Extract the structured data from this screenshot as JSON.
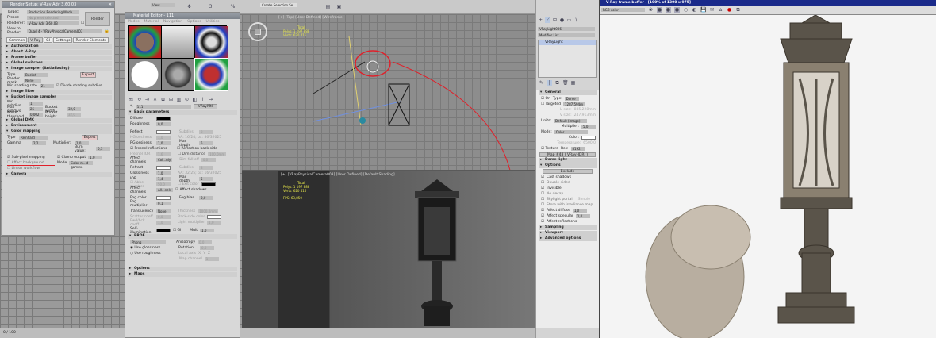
{
  "main_toolbar": {
    "view_dropdown": "View",
    "selection_set": "Create Selection Se"
  },
  "top_viewport": {
    "label": "[+] [Top] [User Defined] [Wireframe]",
    "stats": {
      "total": "Total",
      "polys_label": "Polys:",
      "polys": "1 197 888",
      "verts_label": "Verts:",
      "verts": "620 416"
    }
  },
  "camera_viewport": {
    "label": "[+] [VRayPhysicalCamera003] [User Defined] [Default Shading]",
    "stats": {
      "total": "Total",
      "polys_label": "Polys:",
      "polys": "1 197 888",
      "verts_label": "Verts:",
      "verts": "620 416",
      "fps_label": "FPS:",
      "fps": "63,850"
    }
  },
  "timeline": {
    "frame": "0 / 100"
  },
  "render_setup": {
    "title": "Render Setup: V-Ray Adv 3.60.03",
    "target_label": "Target:",
    "target": "Production Rendering Mode",
    "preset_label": "Preset:",
    "preset": "No preset selected",
    "renderer_label": "Renderer:",
    "renderer": "V-Ray Adv 3.60.03",
    "save_file": "Save File",
    "view_label": "View to Render:",
    "view": "Quad 4 - VRayPhysicalCamera003",
    "render_button": "Render",
    "tabs": [
      "Common",
      "V-Ray",
      "GI",
      "Settings",
      "Render Elements"
    ],
    "rollouts": {
      "authorization": "Authorization",
      "about": "About V-Ray",
      "frame_buffer": "Frame buffer",
      "global_switches": "Global switches",
      "image_sampler": "Image sampler (Antialiasing)",
      "image_filter": "Image filter",
      "bucket": "Bucket image sampler",
      "global_dmc": "Global DMC",
      "environment": "Environment",
      "color_mapping": "Color mapping",
      "camera": "Camera"
    },
    "sampler": {
      "type_label": "Type",
      "type": "Bucket",
      "expert": "Expert",
      "render_mask_label": "Render mask",
      "render_mask": "None",
      "min_shading_label": "Min shading rate",
      "min_shading": "21",
      "divide": "Divide shading subdivs"
    },
    "bucket": {
      "min_subdivs_label": "Min subdivs",
      "min_subdivs": "1",
      "max_subdivs_label": "Max subdivs",
      "max_subdivs": "25",
      "noise_label": "Noise threshold",
      "noise": "0,002",
      "width_label": "Bucket width",
      "width": "32,0",
      "height_label": "Bucket height",
      "height": "32,0"
    },
    "color_mapping": {
      "type_label": "Type",
      "type": "Reinhard",
      "expert": "Expert",
      "gamma_label": "Gamma",
      "gamma": "2,2",
      "multiplier_label": "Multiplier:",
      "multiplier": "1,0",
      "burn_label": "Burn value:",
      "burn": "0,3",
      "sub_pixel": "Sub-pixel mapping",
      "clamp": "Clamp output",
      "clamp_value": "1,0",
      "affect_bg": "Affect background",
      "mode_label": "Mode",
      "mode": "Color m...d gamma",
      "linear": "Linear workflow"
    }
  },
  "material_editor": {
    "title": "Material Editor - 111",
    "menu": [
      "Modes",
      "Material",
      "Navigation",
      "Options",
      "Utilities"
    ],
    "material_name": "111",
    "material_type": "VRayMtl",
    "basic": "Basic parameters",
    "diffuse": "Diffuse",
    "roughness": "Roughness",
    "roughness_v": "0,0",
    "reflect": "Reflect",
    "subdivs": "Subdivs",
    "subdivs_v": "8",
    "hglossiness": "HGlossiness",
    "hgloss_v": "1,0",
    "aa": "AA: 16/24; px: 86/32025",
    "rglossiness": "RGlossiness",
    "rgloss_v": "1,0",
    "max_depth": "Max depth",
    "max_depth_v": "5",
    "fresnel": "Fresnel reflections",
    "reflect_back": "Reflect on back side",
    "fresnel_ior": "Fresnel IOR",
    "fresnel_ior_v": "1,6",
    "dim_distance": "Dim distance",
    "dim_distance_v": "100,0mm",
    "affect_channels": "Affect channels",
    "affect_channels_v": "Col...nly",
    "dim_falloff": "Dim fall off",
    "dim_falloff_v": "0,0",
    "refract": "Refract",
    "r_subdivs_v": "8",
    "glossiness": "Glossiness",
    "gloss_v": "1,0",
    "aa2": "AA: 32/25; px: 16/32025",
    "ior": "IOR",
    "ior_v": "1,4",
    "r_max_depth_v": "5",
    "abbe": "Abbe number",
    "abbe_v": "50,0",
    "exit_color": "Exit color",
    "r_affect_v": "All...nels",
    "affect_shadows": "Affect shadows",
    "fog_color": "Fog color",
    "fog_bias": "Fog bias",
    "fog_bias_v": "0,0",
    "fog_mult": "Fog multiplier",
    "fog_mult_v": "0,1",
    "translucency": "Translucency",
    "translucency_v": "None",
    "thickness": "Thickness",
    "thickness_v": "1000,0mm",
    "scatter": "Scatter coeff",
    "scatter_v": "0,0",
    "back_side": "Back-side color",
    "fwd": "Fwd/bck coeff",
    "fwd_v": "1,0",
    "light_mult": "Light multiplier",
    "light_mult_v": "1,0",
    "self_illum": "Self-illumination",
    "gi": "GI",
    "mult": "Mult",
    "mult_v": "1,0",
    "brdf": "BRDF",
    "brdf_type": "Phong",
    "anisotropy": "Anisotropy",
    "aniso_v": "0,0",
    "rotation": "Rotation",
    "rotation_v": "0,0",
    "use_gloss": "Use glossiness",
    "use_rough": "Use roughness",
    "local_axis": "Local axis",
    "axes": [
      "X",
      "Y",
      "Z"
    ],
    "map_channel": "Map channel",
    "map_channel_v": "1",
    "options": "Options",
    "maps": "Maps"
  },
  "command_panel": {
    "object_name": "VRayLight006",
    "modifier_list": "Modifier List",
    "stack_item": "VRayLight",
    "general": "General",
    "on": "On",
    "type_label": "Type:",
    "type": "Dome",
    "targeted": "Targeted",
    "targeted_v": "1287,594m",
    "u_size": "U size:",
    "u_size_v": "885,228mm",
    "v_size": "V size:",
    "v_size_v": "247,913mm",
    "units_label": "Units:",
    "units": "Default (image)",
    "multiplier_label": "Multiplier:",
    "multiplier": "5,0",
    "mode_label": "Mode:",
    "mode": "Color",
    "color_label": "Color:",
    "temperature_label": "Temperature:",
    "temperature": "6500,0",
    "texture": "Texture",
    "res_label": "Res:",
    "res": "8192",
    "map": "Map #48 ( VRayHDRI )",
    "dome_light": "Dome light",
    "options": "Options",
    "exclude": "Exclude",
    "checks": [
      {
        "label": "Cast shadows",
        "on": true
      },
      {
        "label": "Double-sided",
        "on": false
      },
      {
        "label": "Invisible",
        "on": true
      },
      {
        "label": "No decay",
        "on": false
      },
      {
        "label": "Skylight portal",
        "on": false
      },
      {
        "label": "Store with irradiance map",
        "on": false
      },
      {
        "label": "Affect diffuse",
        "on": true
      },
      {
        "label": "Affect specular",
        "on": true
      },
      {
        "label": "Affect reflections",
        "on": true
      }
    ],
    "simple": "Simple",
    "affect_diffuse_v": "1,0",
    "affect_specular_v": "1,0",
    "sampling": "Sampling",
    "viewport": "Viewport",
    "advanced": "Advanced options"
  },
  "frame_buffer": {
    "title": "V-Ray frame buffer - [100% of 1300 x 975]",
    "channel": "RGB color"
  },
  "colors": {
    "fb_title": "#1a2a8a",
    "annotation": "#e0202a",
    "viewport_active": "#e8e84a"
  }
}
